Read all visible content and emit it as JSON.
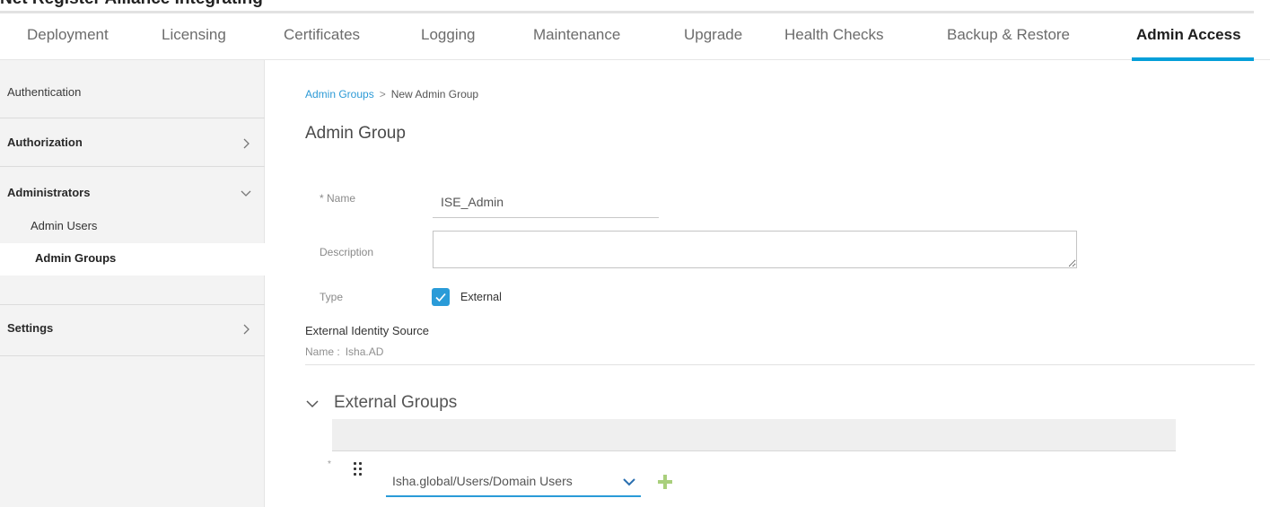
{
  "header": {
    "cut_off_text": "Net Register Alliance Integrating"
  },
  "tabs": [
    {
      "label": "Deployment",
      "active": false
    },
    {
      "label": "Licensing",
      "active": false
    },
    {
      "label": "Certificates",
      "active": false
    },
    {
      "label": "Logging",
      "active": false
    },
    {
      "label": "Maintenance",
      "active": false
    },
    {
      "label": "Upgrade",
      "active": false
    },
    {
      "label": "Health Checks",
      "active": false
    },
    {
      "label": "Backup & Restore",
      "active": false
    },
    {
      "label": "Admin Access",
      "active": true
    }
  ],
  "sidebar": {
    "authentication": "Authentication",
    "authorization": "Authorization",
    "administrators": "Administrators",
    "admin_users": "Admin Users",
    "admin_groups": "Admin Groups",
    "settings": "Settings",
    "selected": "Admin Groups"
  },
  "breadcrumb": {
    "parent": "Admin Groups",
    "separator": ">",
    "current": "New Admin Group"
  },
  "form": {
    "title": "Admin Group",
    "name_label": "* Name",
    "name_value": "ISE_Admin",
    "description_label": "Description",
    "description_value": "",
    "type_label": "Type",
    "type_checked": true,
    "type_option": "External"
  },
  "external_identity_source": {
    "title": "External Identity Source",
    "name_label": "Name :",
    "name_value": "Isha.AD"
  },
  "external_groups": {
    "title": "External Groups",
    "required_marker": "*",
    "selected_group": "Isha.global/Users/Domain Users"
  },
  "colors": {
    "accent": "#049fd9",
    "link": "#2c9ad6",
    "add_icon": "#8bc34a",
    "sidebar_bg": "#f3f3f3"
  },
  "icons": [
    "chevron-right-icon",
    "chevron-down-icon",
    "check-icon",
    "drag-handle-icon",
    "plus-icon"
  ]
}
